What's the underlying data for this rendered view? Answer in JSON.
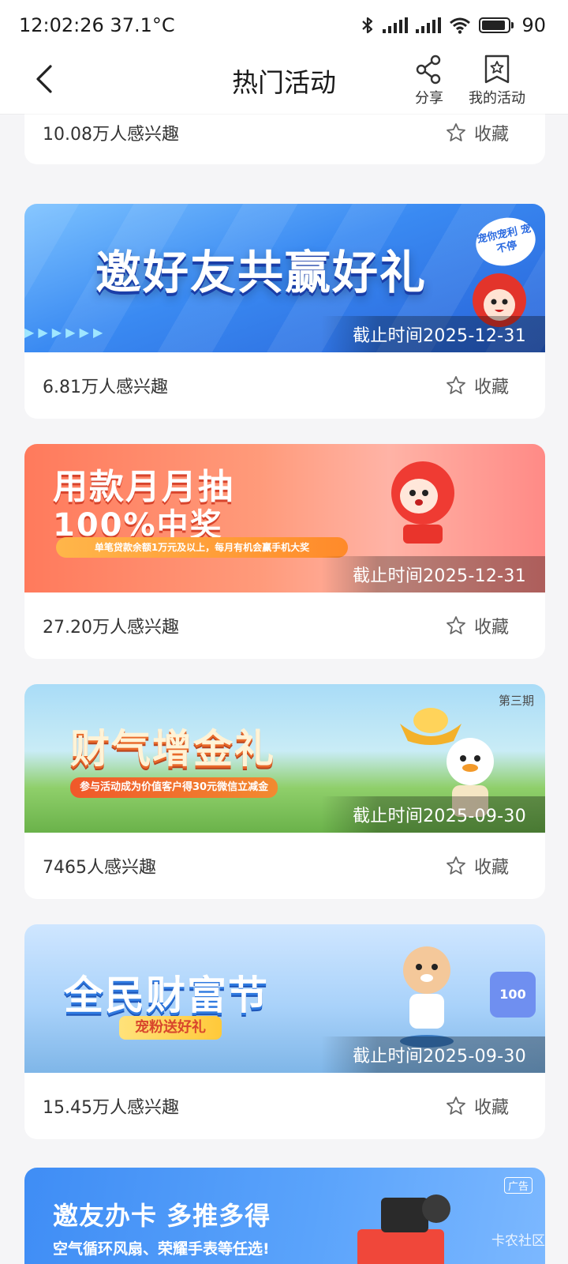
{
  "status_bar": {
    "time_temp": "12:02:26 37.1°C",
    "battery_level": "90"
  },
  "nav": {
    "title": "热门活动",
    "share_label": "分享",
    "my_activity_label": "我的活动"
  },
  "cards": [
    {
      "interest": "10.08万人感兴趣",
      "favorite_label": "收藏"
    },
    {
      "banner_title": "邀好友共赢好礼",
      "badge": "宠你宠利 宠不停",
      "deadline": "截止时间2025-12-31",
      "interest": "6.81万人感兴趣",
      "favorite_label": "收藏"
    },
    {
      "banner_title": "用款月月抽",
      "banner_title2": "100%中奖",
      "banner_sub": "单笔贷款余额1万元及以上，每月有机会赢手机大奖",
      "deadline": "截止时间2025-12-31",
      "interest": "27.20万人感兴趣",
      "favorite_label": "收藏"
    },
    {
      "banner_title": "财气增金礼",
      "banner_sub": "参与活动成为价值客户得30元微信立减金",
      "issue": "第三期",
      "deadline": "截止时间2025-09-30",
      "interest": "7465人感兴趣",
      "favorite_label": "收藏"
    },
    {
      "banner_title": "全民财富节",
      "banner_sub": "宠粉送好礼",
      "deadline": "截止时间2025-09-30",
      "interest": "15.45万人感兴趣",
      "favorite_label": "收藏"
    },
    {
      "banner_title": "邀友办卡 多推多得",
      "banner_sub": "空气循环风扇、荣耀手表等任选!",
      "ad_tag": "广告",
      "watermark": "卡农社区"
    }
  ]
}
